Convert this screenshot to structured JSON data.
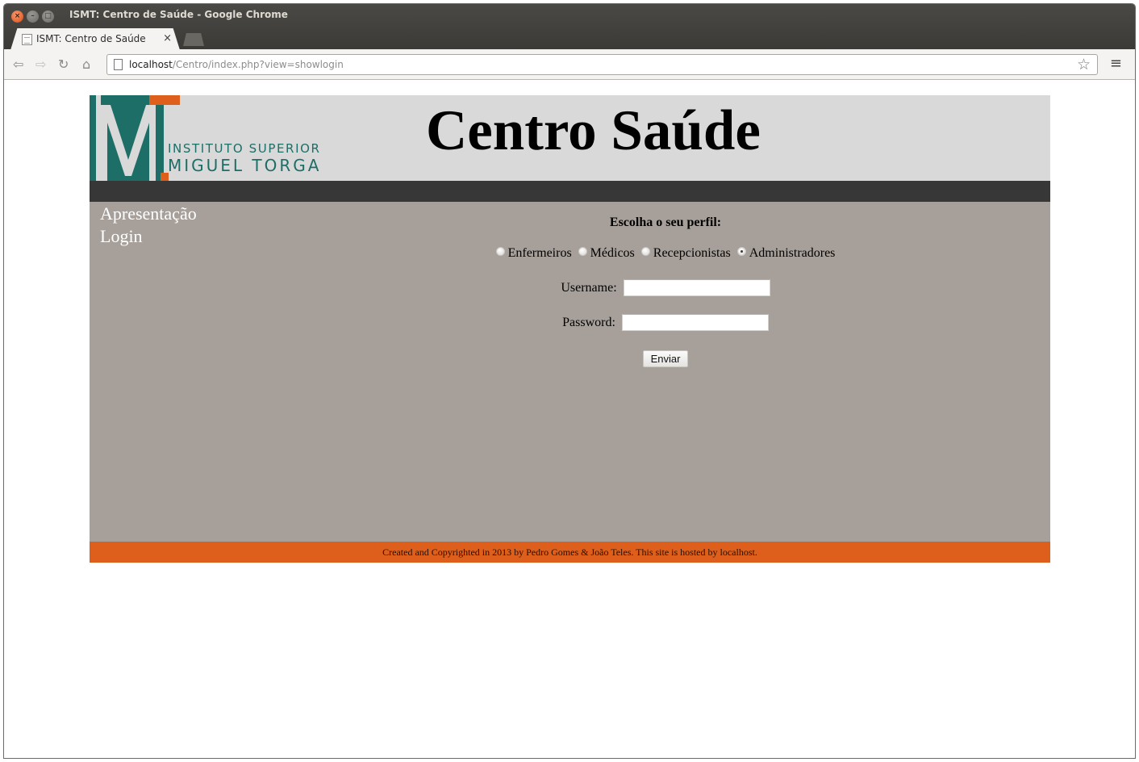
{
  "window": {
    "title": "ISMT: Centro de Saúde - Google Chrome"
  },
  "tab": {
    "title": "ISMT: Centro de Saúde",
    "close_glyph": "×"
  },
  "address_bar": {
    "host": "localhost",
    "path": "/Centro/index.php?view=showlogin"
  },
  "header": {
    "logo_line1": "INSTITUTO SUPERIOR",
    "logo_line2": "MIGUEL TORGA",
    "title": "Centro Saúde"
  },
  "sidebar": {
    "items": [
      {
        "label": "Apresentação"
      },
      {
        "label": "Login"
      }
    ]
  },
  "login_form": {
    "heading": "Escolha o seu perfil:",
    "profiles": [
      {
        "label": "Enfermeiros",
        "checked": false
      },
      {
        "label": "Médicos",
        "checked": false
      },
      {
        "label": "Recepcionistas",
        "checked": false
      },
      {
        "label": "Administradores",
        "checked": true
      }
    ],
    "username_label": "Username:",
    "username_value": "",
    "password_label": "Password:",
    "password_value": "",
    "submit_label": "Enviar"
  },
  "footer": {
    "text": "Created and Copyrighted in 2013 by Pedro Gomes & João Teles. This site is hosted by localhost."
  },
  "colors": {
    "header_bg": "#d9d9d9",
    "navbar_bg": "#373737",
    "content_bg": "#a7a09a",
    "footer_bg": "#de5f1b",
    "logo_teal": "#1e6e68",
    "logo_orange": "#de5f1b"
  }
}
